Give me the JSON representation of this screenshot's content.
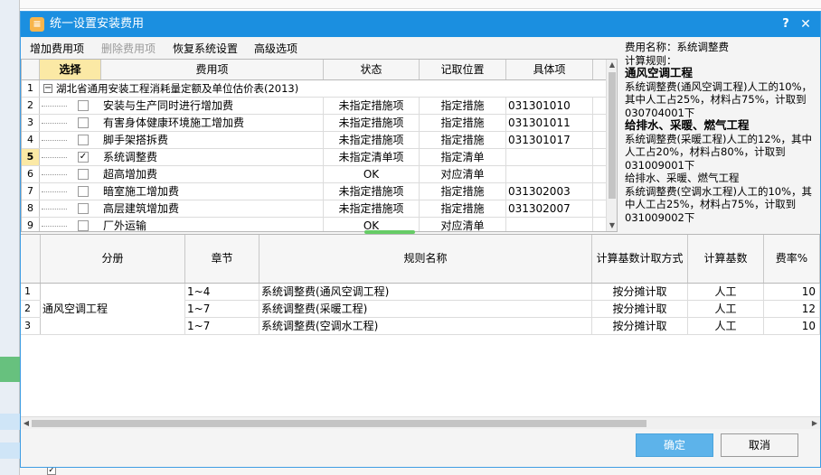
{
  "window": {
    "title": "统一设置安装费用",
    "help_label": "?",
    "close_label": "✕",
    "title_icon": "≡"
  },
  "toolbar": {
    "add": "增加费用项",
    "delete": "删除费用项",
    "restore": "恢复系统设置",
    "advanced": "高级选项"
  },
  "fee_table": {
    "headers": [
      "选择",
      "费用项",
      "状态",
      "记取位置",
      "具体项"
    ],
    "group": {
      "num": "1",
      "expander": "−",
      "label": "湖北省通用安装工程消耗量定额及单位估价表(2013)"
    },
    "rows": [
      {
        "num": "2",
        "checked": "",
        "name": "安装与生产同时进行增加费",
        "status": "未指定措施项",
        "location": "指定措施",
        "item": "031301010"
      },
      {
        "num": "3",
        "checked": "",
        "name": "有害身体健康环境施工增加费",
        "status": "未指定措施项",
        "location": "指定措施",
        "item": "031301011"
      },
      {
        "num": "4",
        "checked": "",
        "name": "脚手架搭拆费",
        "status": "未指定措施项",
        "location": "指定措施",
        "item": "031301017"
      },
      {
        "num": "5",
        "checked": "✓",
        "name": "系统调整费",
        "status": "未指定清单项",
        "location": "指定清单",
        "item": ""
      },
      {
        "num": "6",
        "checked": "",
        "name": "超高增加费",
        "status": "OK",
        "location": "对应清单",
        "item": ""
      },
      {
        "num": "7",
        "checked": "",
        "name": "暗室施工增加费",
        "status": "未指定措施项",
        "location": "指定措施",
        "item": "031302003"
      },
      {
        "num": "8",
        "checked": "",
        "name": "高层建筑增加费",
        "status": "未指定措施项",
        "location": "指定措施",
        "item": "031302007"
      },
      {
        "num": "9",
        "checked": "",
        "name": "厂外运输",
        "status": "OK",
        "location": "对应清单",
        "item": ""
      }
    ]
  },
  "info": {
    "fee_name": "费用名称：系统调整费",
    "calc_rule": "计算规则：",
    "sections": [
      {
        "heading": "通风空调工程",
        "text": "系统调整费(通风空调工程)人工的10%，其中人工占25%，材料占75%，计取到030704001下"
      },
      {
        "heading": "给排水、采暖、燃气工程",
        "text": "系统调整费(采暖工程)人工的12%，其中人工占20%，材料占80%，计取到031009001下"
      },
      {
        "heading": "给排水、采暖、燃气工程",
        "text": "系统调整费(空调水工程)人工的10%，其中人工占25%，材料占75%，计取到031009002下"
      }
    ]
  },
  "rule_table": {
    "headers": [
      "分册",
      "章节",
      "规则名称",
      "计算基数计取方式",
      "计算基数",
      "费率%"
    ],
    "division": "通风空调工程",
    "rows": [
      {
        "num": "1",
        "chapter": "1~4",
        "rule": "系统调整费(通风空调工程)",
        "method": "按分摊计取",
        "base": "人工",
        "rate": "10"
      },
      {
        "num": "2",
        "chapter": "1~7",
        "rule": "系统调整费(采暖工程)",
        "method": "按分摊计取",
        "base": "人工",
        "rate": "12"
      },
      {
        "num": "3",
        "chapter": "1~7",
        "rule": "系统调整费(空调水工程)",
        "method": "按分摊计取",
        "base": "人工",
        "rate": "10"
      }
    ]
  },
  "footer": {
    "ok": "确定",
    "cancel": "取消"
  },
  "colors": {
    "title_bar": "#1b8fe0",
    "selected_header": "#fbe9a5",
    "ok_button": "#5db3ea",
    "accent_green": "#6bc27d"
  },
  "icons": {
    "title": "app-icon",
    "help": "help-icon",
    "close": "close-icon",
    "expander": "collapse-icon",
    "scroll_up": "up-arrow-icon",
    "scroll_down": "down-arrow-icon",
    "scroll_left": "left-arrow-icon",
    "scroll_right": "right-arrow-icon"
  }
}
